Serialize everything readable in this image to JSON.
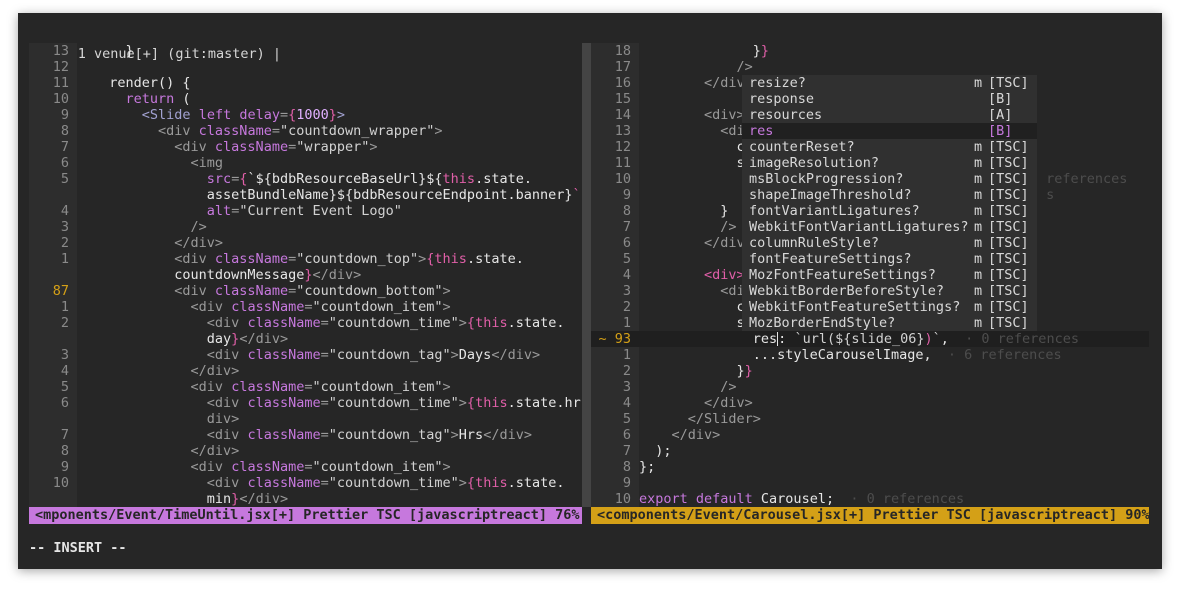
{
  "tabline": {
    "text": "1 venue[+] (git:master)"
  },
  "left": {
    "lines": [
      {
        "n": "13",
        "segs": [
          [
            "    }",
            "t"
          ]
        ]
      },
      {
        "n": "12",
        "segs": [
          [
            "",
            ""
          ]
        ]
      },
      {
        "n": "11",
        "segs": [
          [
            "  render() {",
            "t"
          ]
        ]
      },
      {
        "n": "10",
        "segs": [
          [
            "    ",
            "t"
          ],
          [
            "return",
            "kw"
          ],
          [
            " (",
            "t"
          ]
        ]
      },
      {
        "n": "9",
        "segs": [
          [
            "      ",
            "t"
          ],
          [
            "<Slide ",
            "jsx"
          ],
          [
            "left delay",
            "attr"
          ],
          [
            "=",
            "tag"
          ],
          [
            "{",
            "brace"
          ],
          [
            "1000",
            "num"
          ],
          [
            "}",
            "brace"
          ],
          [
            ">",
            "jsx"
          ]
        ]
      },
      {
        "n": "8",
        "segs": [
          [
            "        ",
            "t"
          ],
          [
            "<div ",
            "tag"
          ],
          [
            "className",
            "attr"
          ],
          [
            "=",
            "tag"
          ],
          [
            "\"countdown_wrapper\"",
            "str"
          ],
          [
            ">",
            "tag"
          ]
        ]
      },
      {
        "n": "7",
        "segs": [
          [
            "          ",
            "t"
          ],
          [
            "<div ",
            "tag"
          ],
          [
            "className",
            "attr"
          ],
          [
            "=",
            "tag"
          ],
          [
            "\"wrapper\"",
            "str"
          ],
          [
            ">",
            "tag"
          ]
        ]
      },
      {
        "n": "6",
        "segs": [
          [
            "            ",
            "t"
          ],
          [
            "<img",
            "tag"
          ]
        ]
      },
      {
        "n": "5",
        "segs": [
          [
            "              ",
            "t"
          ],
          [
            "src",
            "attr"
          ],
          [
            "=",
            "tag"
          ],
          [
            "{",
            "brace"
          ],
          [
            "`${bdbResourceBaseUrl}${",
            "t"
          ],
          [
            "this",
            "this"
          ],
          [
            ".state.",
            "t"
          ]
        ]
      },
      {
        "n": "",
        "segs": [
          [
            "              assetBundleName}${bdbResourceEndpoint.banner}",
            "t"
          ],
          [
            "`}",
            "brace"
          ]
        ]
      },
      {
        "n": "4",
        "segs": [
          [
            "              ",
            "t"
          ],
          [
            "alt",
            "attr"
          ],
          [
            "=",
            "tag"
          ],
          [
            "\"Current Event Logo\"",
            "str"
          ]
        ]
      },
      {
        "n": "3",
        "segs": [
          [
            "            ",
            "t"
          ],
          [
            "/>",
            "tag"
          ]
        ]
      },
      {
        "n": "2",
        "segs": [
          [
            "          ",
            "t"
          ],
          [
            "</div>",
            "tag"
          ]
        ]
      },
      {
        "n": "1",
        "segs": [
          [
            "          ",
            "t"
          ],
          [
            "<div ",
            "tag"
          ],
          [
            "className",
            "attr"
          ],
          [
            "=",
            "tag"
          ],
          [
            "\"countdown_top\"",
            "str"
          ],
          [
            ">",
            "tag"
          ],
          [
            "{",
            "brace"
          ],
          [
            "this",
            "this"
          ],
          [
            ".state.",
            "t"
          ]
        ]
      },
      {
        "n": "",
        "segs": [
          [
            "          countdownMessage",
            "t"
          ],
          [
            "}",
            "brace"
          ],
          [
            "</div>",
            "tag"
          ]
        ]
      },
      {
        "n": "87",
        "cur": true,
        "segs": [
          [
            "          ",
            "t"
          ],
          [
            "<div ",
            "tag"
          ],
          [
            "className",
            "attr"
          ],
          [
            "=",
            "tag"
          ],
          [
            "\"countdown_bottom\"",
            "str"
          ],
          [
            ">",
            "tag"
          ]
        ]
      },
      {
        "n": "1",
        "segs": [
          [
            "            ",
            "t"
          ],
          [
            "<div ",
            "tag"
          ],
          [
            "className",
            "attr"
          ],
          [
            "=",
            "tag"
          ],
          [
            "\"countdown_item\"",
            "str"
          ],
          [
            ">",
            "tag"
          ]
        ]
      },
      {
        "n": "2",
        "segs": [
          [
            "              ",
            "t"
          ],
          [
            "<div ",
            "tag"
          ],
          [
            "className",
            "attr"
          ],
          [
            "=",
            "tag"
          ],
          [
            "\"countdown_time\"",
            "str"
          ],
          [
            ">",
            "tag"
          ],
          [
            "{",
            "brace"
          ],
          [
            "this",
            "this"
          ],
          [
            ".state.",
            "t"
          ]
        ]
      },
      {
        "n": "",
        "segs": [
          [
            "              day",
            "t"
          ],
          [
            "}",
            "brace"
          ],
          [
            "</div>",
            "tag"
          ]
        ]
      },
      {
        "n": "3",
        "segs": [
          [
            "              ",
            "t"
          ],
          [
            "<div ",
            "tag"
          ],
          [
            "className",
            "attr"
          ],
          [
            "=",
            "tag"
          ],
          [
            "\"countdown_tag\"",
            "str"
          ],
          [
            ">",
            "tag"
          ],
          [
            "Days",
            "t"
          ],
          [
            "</div>",
            "tag"
          ]
        ]
      },
      {
        "n": "4",
        "segs": [
          [
            "            ",
            "t"
          ],
          [
            "</div>",
            "tag"
          ]
        ]
      },
      {
        "n": "5",
        "segs": [
          [
            "            ",
            "t"
          ],
          [
            "<div ",
            "tag"
          ],
          [
            "className",
            "attr"
          ],
          [
            "=",
            "tag"
          ],
          [
            "\"countdown_item\"",
            "str"
          ],
          [
            ">",
            "tag"
          ]
        ]
      },
      {
        "n": "6",
        "segs": [
          [
            "              ",
            "t"
          ],
          [
            "<div ",
            "tag"
          ],
          [
            "className",
            "attr"
          ],
          [
            "=",
            "tag"
          ],
          [
            "\"countdown_time\"",
            "str"
          ],
          [
            ">",
            "tag"
          ],
          [
            "{",
            "brace"
          ],
          [
            "this",
            "this"
          ],
          [
            ".state.hr",
            "t"
          ],
          [
            "}",
            "brace"
          ],
          [
            "</",
            "tag"
          ]
        ]
      },
      {
        "n": "",
        "segs": [
          [
            "              div>",
            "tag"
          ]
        ]
      },
      {
        "n": "7",
        "segs": [
          [
            "              ",
            "t"
          ],
          [
            "<div ",
            "tag"
          ],
          [
            "className",
            "attr"
          ],
          [
            "=",
            "tag"
          ],
          [
            "\"countdown_tag\"",
            "str"
          ],
          [
            ">",
            "tag"
          ],
          [
            "Hrs",
            "t"
          ],
          [
            "</div>",
            "tag"
          ]
        ]
      },
      {
        "n": "8",
        "segs": [
          [
            "            ",
            "t"
          ],
          [
            "</div>",
            "tag"
          ]
        ]
      },
      {
        "n": "9",
        "segs": [
          [
            "            ",
            "t"
          ],
          [
            "<div ",
            "tag"
          ],
          [
            "className",
            "attr"
          ],
          [
            "=",
            "tag"
          ],
          [
            "\"countdown_item\"",
            "str"
          ],
          [
            ">",
            "tag"
          ]
        ]
      },
      {
        "n": "10",
        "segs": [
          [
            "              ",
            "t"
          ],
          [
            "<div ",
            "tag"
          ],
          [
            "className",
            "attr"
          ],
          [
            "=",
            "tag"
          ],
          [
            "\"countdown_time\"",
            "str"
          ],
          [
            ">",
            "tag"
          ],
          [
            "{",
            "brace"
          ],
          [
            "this",
            "this"
          ],
          [
            ".state.",
            "t"
          ]
        ]
      },
      {
        "n": "",
        "segs": [
          [
            "              min",
            "t"
          ],
          [
            "}",
            "brace"
          ],
          [
            "</div>",
            "tag"
          ]
        ]
      }
    ],
    "status": "<mponents/Event/TimeUntil.jsx[+] Prettier TSC [javascriptreact] 76%"
  },
  "right": {
    "lines": [
      {
        "n": "18",
        "segs": [
          [
            "              }",
            "t"
          ],
          [
            "}",
            "brace"
          ]
        ]
      },
      {
        "n": "17",
        "segs": [
          [
            "            ",
            "t"
          ],
          [
            "/>",
            "tag"
          ]
        ]
      },
      {
        "n": "16",
        "segs": [
          [
            "        ",
            "t"
          ],
          [
            "</div>",
            "tag"
          ]
        ]
      },
      {
        "n": "15",
        "segs": [
          [
            "",
            ""
          ]
        ]
      },
      {
        "n": "14",
        "segs": [
          [
            "        ",
            "t"
          ],
          [
            "<div>",
            "tag"
          ]
        ]
      },
      {
        "n": "13",
        "segs": [
          [
            "          ",
            "t"
          ],
          [
            "<di",
            "tag"
          ]
        ]
      },
      {
        "n": "12",
        "segs": [
          [
            "            c",
            "t"
          ]
        ]
      },
      {
        "n": "11",
        "segs": [
          [
            "            s",
            "t"
          ]
        ]
      },
      {
        "n": "10",
        "segs": [
          [
            "",
            ""
          ]
        ]
      },
      {
        "n": "9",
        "segs": [
          [
            "",
            ""
          ]
        ]
      },
      {
        "n": "8",
        "segs": [
          [
            "          }",
            "t"
          ]
        ]
      },
      {
        "n": "7",
        "segs": [
          [
            "          ",
            "t"
          ],
          [
            "/>",
            "tag"
          ]
        ]
      },
      {
        "n": "6",
        "segs": [
          [
            "        ",
            "t"
          ],
          [
            "</div",
            "tag"
          ]
        ]
      },
      {
        "n": "5",
        "segs": [
          [
            "",
            ""
          ]
        ]
      },
      {
        "n": "4",
        "segs": [
          [
            "        ",
            "t"
          ],
          [
            "<div>",
            "brace"
          ]
        ]
      },
      {
        "n": "3",
        "segs": [
          [
            "          ",
            "t"
          ],
          [
            "<di",
            "tag"
          ]
        ]
      },
      {
        "n": "2",
        "segs": [
          [
            "            c",
            "t"
          ]
        ]
      },
      {
        "n": "1",
        "segs": [
          [
            "            s",
            "t"
          ]
        ]
      },
      {
        "n": "~ 93",
        "cur": true,
        "curline": true,
        "segs": [
          [
            "              res",
            "t"
          ],
          [
            "|",
            "cursor"
          ],
          [
            ": ",
            "t"
          ],
          [
            "`url(${slide_06}",
            "str"
          ],
          [
            ")",
            "brace"
          ],
          [
            "`",
            "str"
          ],
          [
            ",",
            "t"
          ],
          [
            "  · 0 references",
            "ghost"
          ]
        ]
      },
      {
        "n": "1",
        "segs": [
          [
            "              ...styleCarouselImage,",
            "t"
          ],
          [
            "  · 6 references",
            "ghost"
          ]
        ]
      },
      {
        "n": "2",
        "segs": [
          [
            "            }",
            "t"
          ],
          [
            "}",
            "brace"
          ]
        ]
      },
      {
        "n": "3",
        "segs": [
          [
            "          ",
            "t"
          ],
          [
            "/>",
            "tag"
          ]
        ]
      },
      {
        "n": "4",
        "segs": [
          [
            "        ",
            "t"
          ],
          [
            "</div>",
            "tag"
          ]
        ]
      },
      {
        "n": "5",
        "segs": [
          [
            "      ",
            "t"
          ],
          [
            "</Slider>",
            "tag"
          ]
        ]
      },
      {
        "n": "6",
        "segs": [
          [
            "    ",
            "t"
          ],
          [
            "</div>",
            "tag"
          ]
        ]
      },
      {
        "n": "7",
        "segs": [
          [
            "  );",
            "t"
          ]
        ]
      },
      {
        "n": "8",
        "segs": [
          [
            "};",
            "t"
          ]
        ]
      },
      {
        "n": "9",
        "segs": [
          [
            "",
            ""
          ]
        ]
      },
      {
        "n": "10",
        "segs": [
          [
            "export default",
            "kw"
          ],
          [
            " Carousel;",
            "t"
          ],
          [
            "  · 0 references",
            "ghost"
          ]
        ]
      }
    ],
    "ghost_right": [
      {
        "row": 8,
        "text": " references"
      },
      {
        "row": 9,
        "text": " s"
      }
    ],
    "status": "<components/Event/Carousel.jsx[+] Prettier TSC [javascriptreact] 90%"
  },
  "completion": [
    {
      "word": "resize?",
      "m": "m",
      "kind": "[TSC]"
    },
    {
      "word": "response",
      "m": "",
      "kind": "[B]"
    },
    {
      "word": "resources",
      "m": "",
      "kind": "[A]"
    },
    {
      "word": "res",
      "m": "",
      "kind": "[B]",
      "selected": true
    },
    {
      "word": "counterReset?",
      "m": "m",
      "kind": "[TSC]"
    },
    {
      "word": "imageResolution?",
      "m": "m",
      "kind": "[TSC]"
    },
    {
      "word": "msBlockProgression?",
      "m": "m",
      "kind": "[TSC]"
    },
    {
      "word": "shapeImageThreshold?",
      "m": "m",
      "kind": "[TSC]"
    },
    {
      "word": "fontVariantLigatures?",
      "m": "m",
      "kind": "[TSC]"
    },
    {
      "word": "WebkitFontVariantLigatures?",
      "m": "m",
      "kind": "[TSC]"
    },
    {
      "word": "columnRuleStyle?",
      "m": "m",
      "kind": "[TSC]"
    },
    {
      "word": "fontFeatureSettings?",
      "m": "m",
      "kind": "[TSC]"
    },
    {
      "word": "MozFontFeatureSettings?",
      "m": "m",
      "kind": "[TSC]"
    },
    {
      "word": "WebkitBorderBeforeStyle?",
      "m": "m",
      "kind": "[TSC]"
    },
    {
      "word": "WebkitFontFeatureSettings?",
      "m": "m",
      "kind": "[TSC]"
    },
    {
      "word": "MozBorderEndStyle?",
      "m": "m",
      "kind": "[TSC]"
    }
  ],
  "mode": "-- INSERT --",
  "colors": {
    "left_status": "#c678dd",
    "right_status": "#d4a017",
    "background": "#262626"
  }
}
